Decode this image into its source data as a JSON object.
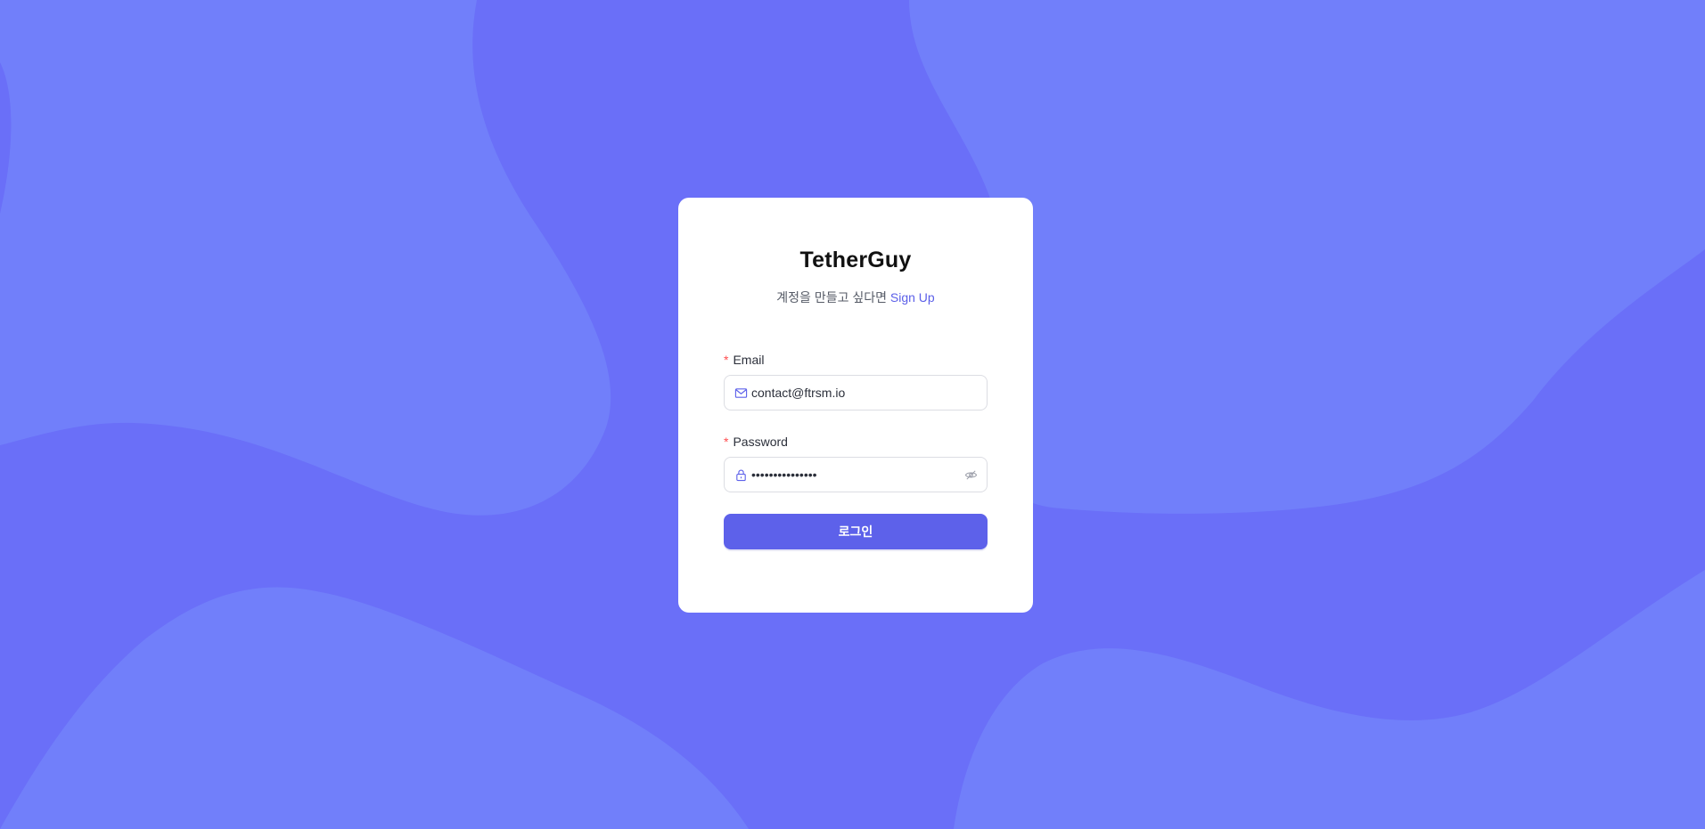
{
  "app": {
    "title": "TetherGuy"
  },
  "signup_prompt": {
    "text": "계정을 만들고 싶다면",
    "link_label": "Sign Up"
  },
  "form": {
    "email": {
      "label": "Email",
      "required_mark": "*",
      "value": "contact@ftrsm.io",
      "icon": "mail-icon"
    },
    "password": {
      "label": "Password",
      "required_mark": "*",
      "value": "•••••••••••••••",
      "icon": "lock-icon",
      "toggle_icon": "eye-invisible-icon"
    },
    "submit_label": "로그인"
  },
  "colors": {
    "background": "#6a6ff8",
    "background_light": "#717ffa",
    "accent": "#5d61ea",
    "required": "#ff4d4f"
  }
}
